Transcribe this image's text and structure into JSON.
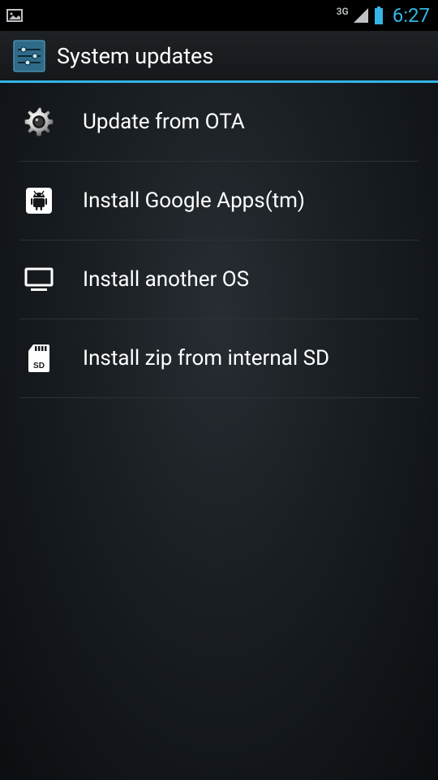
{
  "status": {
    "network": "3G",
    "time": "6:27"
  },
  "header": {
    "title": "System updates"
  },
  "items": [
    {
      "label": "Update from OTA",
      "icon": "gear-icon"
    },
    {
      "label": "Install Google Apps(tm)",
      "icon": "android-box-icon"
    },
    {
      "label": "Install another OS",
      "icon": "monitor-icon"
    },
    {
      "label": "Install zip from internal SD",
      "icon": "sd-card-icon"
    }
  ],
  "colors": {
    "accent": "#33b5e5"
  }
}
